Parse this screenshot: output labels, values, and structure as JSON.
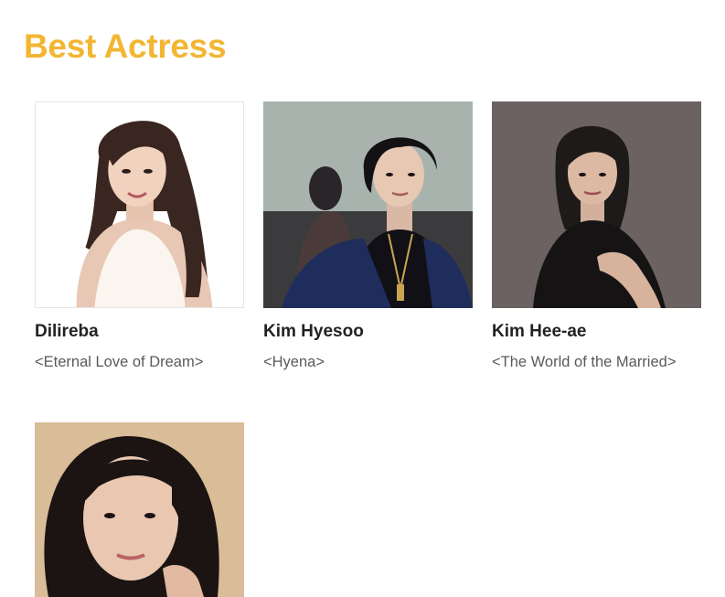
{
  "heading": "Best Actress",
  "nominees": [
    {
      "name": "Dilireba",
      "work": "<Eternal Love of Dream>"
    },
    {
      "name": "Kim Hyesoo",
      "work": "<Hyena>"
    },
    {
      "name": "Kim Hee-ae",
      "work": "<The World of the Married>"
    },
    {
      "name": "",
      "work": ""
    }
  ],
  "colors": {
    "heading": "#F2B632",
    "name_text": "#222222",
    "work_text": "#5a5a5a"
  }
}
